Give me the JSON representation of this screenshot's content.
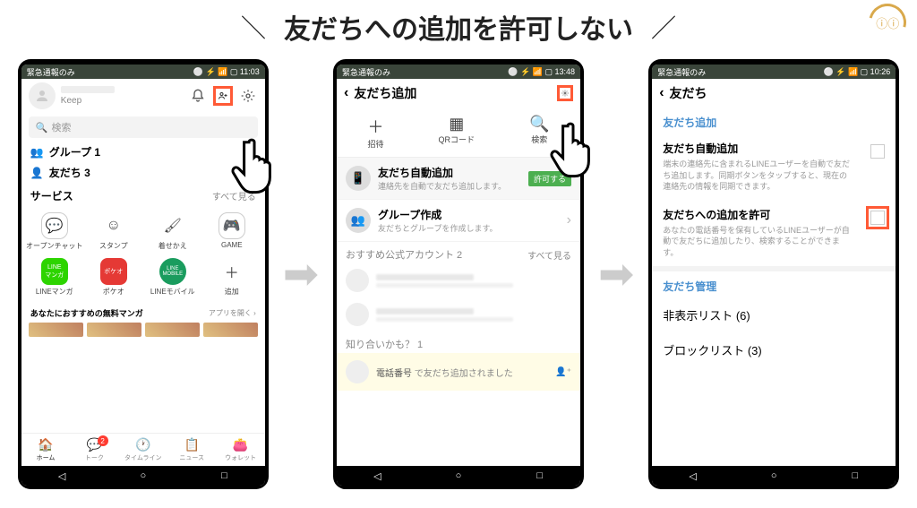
{
  "title": "友だちへの追加を許可しない",
  "slashL": "＼",
  "slashR": "／",
  "logo": "ちい\nラボ",
  "arrow": "➡",
  "screen1": {
    "status_left": "緊急通報のみ",
    "status_right": "⚪ ⚡ 📶 ▢ 11:03",
    "keep": "Keep",
    "search_placeholder": "検索",
    "group_label": "グループ 1",
    "friend_label": "友だち 3",
    "service_header": "サービス",
    "see_all": "すべて見る",
    "svc1": "オープンチャット",
    "svc2": "スタンプ",
    "svc3": "着せかえ",
    "svc4": "GAME",
    "svc5": "LINEマンガ",
    "svc6": "ポケオ",
    "svc7": "LINEモバイル",
    "svc8": "追加",
    "recommend": "あなたにおすすめの無料マンガ",
    "open_app": "アプリを開く ›",
    "nav1": "ホーム",
    "nav2": "トーク",
    "nav3": "タイムライン",
    "nav4": "ニュース",
    "nav5": "ウォレット",
    "badge": "2"
  },
  "screen2": {
    "status_left": "緊急通報のみ",
    "status_right": "⚪ ⚡ 📶 ▢ 13:48",
    "title": "友だち追加",
    "m1": "招待",
    "m2": "QRコード",
    "m3": "検索",
    "auto_add_title": "友だち自動追加",
    "auto_add_sub": "連絡先を自動で友だち追加します。",
    "permit": "許可する",
    "group_create_title": "グループ作成",
    "group_create_sub": "友だちとグループを作成します。",
    "official_header": "おすすめ公式アカウント 2",
    "see_all": "すべて見る",
    "acquaint": "知り合いかも？ 1",
    "tel_label": "電話番号",
    "tel_sub": "で友だち追加されました"
  },
  "screen3": {
    "status_left": "緊急通報のみ",
    "status_right": "⚪ ⚡ 📶 ▢ 10:26",
    "title": "友だち",
    "sec_add": "友だち追加",
    "auto_title": "友だち自動追加",
    "auto_desc": "端末の連絡先に含まれるLINEユーザーを自動で友だち追加します。同期ボタンをタップすると、現在の連絡先の情報を同期できます。",
    "allow_title": "友だちへの追加を許可",
    "allow_desc": "あなたの電話番号を保有しているLINEユーザーが自動で友だちに追加したり、検索することができます。",
    "sec_manage": "友だち管理",
    "hidden_list": "非表示リスト (6)",
    "block_list": "ブロックリスト (3)"
  }
}
